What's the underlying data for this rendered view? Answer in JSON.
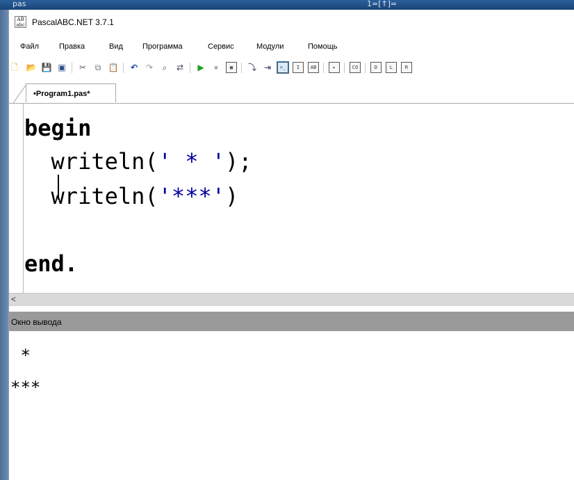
{
  "desktop": {
    "title_fragment": "pas",
    "title_fragment_right": "1=[↑]="
  },
  "window": {
    "title": "PascalABC.NET 3.7.1",
    "icon": "ab-app-icon"
  },
  "menu": [
    "Файл",
    "Правка",
    "Вид",
    "Программа",
    "Сервис",
    "Модули",
    "Помощь"
  ],
  "toolbar": {
    "icons": [
      "new-file-icon",
      "open-icon",
      "save-icon",
      "save-all-icon",
      "cut-icon",
      "copy-icon",
      "paste-icon",
      "undo-icon",
      "redo-icon",
      "find-icon",
      "replace-icon",
      "run-icon",
      "stop-icon",
      "debug-window-icon",
      "step-into-icon",
      "step-over-icon",
      "console-icon",
      "format-icon",
      "intellisense-icon",
      "compile-icon",
      "code-template-icon",
      "form-designer-icon",
      "debug-icon",
      "release-icon"
    ]
  },
  "tab": {
    "label": "•Program1.pas*"
  },
  "editor": {
    "lines": [
      {
        "kw": "begin"
      },
      {
        "fn": "  writeln(",
        "str": "' * '",
        "tail": ");"
      },
      {
        "fn": "  writeln(",
        "str": "'***'",
        "tail": ")"
      },
      {
        "kw": "end",
        "tail": "."
      }
    ]
  },
  "scroll": {
    "left_arrow": "<"
  },
  "output": {
    "header": "Окно вывода",
    "lines": [
      " *",
      "***"
    ]
  },
  "colors": {
    "string": "#0000a0",
    "output_header": "#9a9a9a",
    "desktop": "#1e4f86"
  }
}
